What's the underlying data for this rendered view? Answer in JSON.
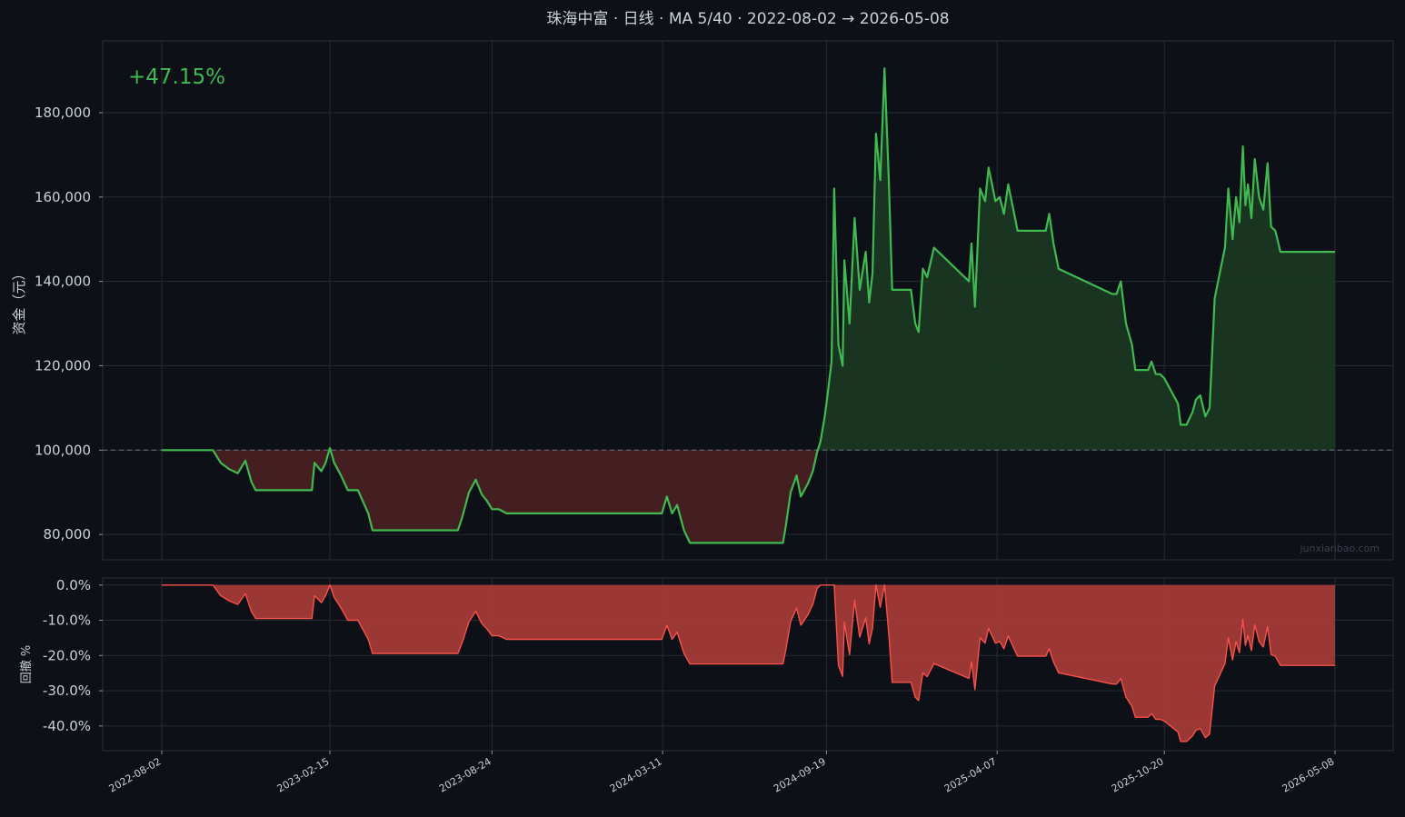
{
  "title": "珠海中富 · 日线 · MA 5/40 · 2022-08-02 → 2026-05-08",
  "watermark": "junxianbao.com",
  "return_label": "+47.15%",
  "colors": {
    "background": "#0d1017",
    "panel": "#0d1017",
    "grid": "#262b33",
    "text": "#c9d1d9",
    "equity_line": "#3fb950",
    "gain_fill": "#1b3a22",
    "loss_fill": "#4a2022",
    "drawdown_line": "#f85149",
    "drawdown_fill": "#a33a37",
    "baseline": "#6b7280"
  },
  "chart_data": [
    {
      "type": "area",
      "ylabel": "资金（元）",
      "ylim": [
        74000,
        197000
      ],
      "yticks": [
        80000,
        100000,
        120000,
        140000,
        160000,
        180000
      ],
      "ytick_labels": [
        "80,000",
        "100,000",
        "120,000",
        "140,000",
        "160,000",
        "180,000"
      ],
      "baseline": 100000,
      "x_start": "2022-08-02",
      "x_end": "2026-05-08",
      "xticks": [
        "2022-08-02",
        "2023-02-15",
        "2023-08-24",
        "2024-03-11",
        "2024-09-19",
        "2025-04-07",
        "2025-10-20",
        "2026-05-08"
      ],
      "grid": true,
      "series": [
        {
          "x": [
            "2022-08-02",
            "2022-10-01",
            "2022-10-10",
            "2022-10-20",
            "2022-10-30",
            "2022-11-08",
            "2022-11-15",
            "2022-11-20",
            "2023-01-25",
            "2023-01-28",
            "2023-02-05",
            "2023-02-10",
            "2023-02-15",
            "2023-02-20",
            "2023-02-28",
            "2023-03-08",
            "2023-03-20",
            "2023-04-01",
            "2023-04-06",
            "2023-04-12",
            "2023-05-01",
            "2023-07-15",
            "2023-07-20",
            "2023-07-28",
            "2023-08-05",
            "2023-08-12",
            "2023-08-18",
            "2023-08-24",
            "2023-09-01",
            "2023-09-10",
            "2023-09-20",
            "2023-10-05",
            "2024-01-15",
            "2024-03-01",
            "2024-03-10",
            "2024-03-16",
            "2024-03-22",
            "2024-03-28",
            "2024-04-05",
            "2024-04-12",
            "2024-04-16",
            "2024-05-01",
            "2024-07-30",
            "2024-08-02",
            "2024-08-08",
            "2024-08-15",
            "2024-08-20",
            "2024-08-28",
            "2024-09-03",
            "2024-09-08",
            "2024-09-12",
            "2024-09-17",
            "2024-09-19",
            "2024-09-25",
            "2024-09-28",
            "2024-10-03",
            "2024-10-08",
            "2024-10-10",
            "2024-10-16",
            "2024-10-22",
            "2024-10-28",
            "2024-11-04",
            "2024-11-08",
            "2024-11-12",
            "2024-11-16",
            "2024-11-21",
            "2024-11-26",
            "2024-12-01",
            "2024-12-05",
            "2024-12-10",
            "2024-12-14",
            "2024-12-18",
            "2024-12-22",
            "2024-12-27",
            "2025-01-01",
            "2025-01-05",
            "2025-01-10",
            "2025-01-15",
            "2025-01-23",
            "2025-03-05",
            "2025-03-08",
            "2025-03-12",
            "2025-03-18",
            "2025-03-24",
            "2025-03-28",
            "2025-04-01",
            "2025-04-05",
            "2025-04-10",
            "2025-04-15",
            "2025-04-20",
            "2025-04-25",
            "2025-05-01",
            "2025-05-06",
            "2025-05-10",
            "2025-05-14",
            "2025-05-18",
            "2025-05-22",
            "2025-05-26",
            "2025-05-30",
            "2025-06-03",
            "2025-06-07",
            "2025-06-12",
            "2025-06-18",
            "2025-08-20",
            "2025-08-25",
            "2025-08-30",
            "2025-09-05",
            "2025-09-12",
            "2025-09-16",
            "2025-09-22",
            "2025-09-25",
            "2025-10-01",
            "2025-10-05",
            "2025-10-10",
            "2025-10-15",
            "2025-10-20",
            "2025-11-05",
            "2025-11-08",
            "2025-11-15",
            "2025-11-22",
            "2025-11-26",
            "2025-12-01",
            "2025-12-07",
            "2025-12-12",
            "2025-12-18",
            "2025-12-24",
            "2025-12-30",
            "2026-01-03",
            "2026-01-08",
            "2026-01-12",
            "2026-01-16",
            "2026-01-20",
            "2026-01-23",
            "2026-01-26",
            "2026-01-30",
            "2026-02-03",
            "2026-02-08",
            "2026-02-13",
            "2026-02-18",
            "2026-02-22",
            "2026-02-27",
            "2026-03-05",
            "2026-05-08"
          ],
          "y": [
            100000,
            100000,
            97000,
            95500,
            94500,
            97500,
            92500,
            90500,
            90500,
            97000,
            95000,
            97000,
            100500,
            97000,
            94000,
            90500,
            90500,
            85000,
            81000,
            81000,
            81000,
            81000,
            84000,
            90000,
            93000,
            89500,
            88000,
            86000,
            86000,
            85000,
            85000,
            85000,
            85000,
            85000,
            85000,
            89000,
            85000,
            87000,
            81000,
            78000,
            78000,
            78000,
            78000,
            81500,
            90000,
            94000,
            89000,
            92000,
            95000,
            99500,
            102000,
            108000,
            111000,
            121000,
            162000,
            125000,
            120000,
            145000,
            130000,
            155000,
            138000,
            147000,
            135000,
            142000,
            175000,
            164000,
            190500,
            164000,
            138000,
            138000,
            138000,
            138000,
            138000,
            138000,
            130000,
            128000,
            143000,
            141000,
            148000,
            140000,
            149000,
            134000,
            162000,
            159000,
            167000,
            163000,
            159000,
            160000,
            156000,
            163000,
            158000,
            152000,
            152000,
            152000,
            152000,
            152000,
            152000,
            152000,
            152000,
            152000,
            156000,
            149000,
            143000,
            137000,
            137000,
            140000,
            130000,
            125000,
            119000,
            119000,
            119000,
            119000,
            121000,
            118000,
            118000,
            117000,
            111000,
            106000,
            106000,
            109000,
            112000,
            113000,
            108000,
            110000,
            136000,
            142000,
            148000,
            162000,
            150000,
            160000,
            154000,
            172000,
            158000,
            163000,
            155000,
            169000,
            160000,
            157000,
            168000,
            153000,
            152000,
            147000,
            147000
          ]
        }
      ]
    },
    {
      "type": "area",
      "ylabel": "回撤 %",
      "ylim": [
        -47,
        2
      ],
      "yticks": [
        0,
        -10,
        -20,
        -30,
        -40
      ],
      "ytick_labels": [
        "0.0%",
        "-10.0%",
        "-20.0%",
        "-30.0%",
        "-40.0%"
      ],
      "grid": true,
      "series": [
        {
          "x": [
            "2022-08-02",
            "2022-10-01",
            "2022-10-10",
            "2022-10-20",
            "2022-10-30",
            "2022-11-08",
            "2022-11-15",
            "2022-11-20",
            "2023-01-25",
            "2023-01-28",
            "2023-02-05",
            "2023-02-10",
            "2023-02-15",
            "2023-02-20",
            "2023-02-28",
            "2023-03-08",
            "2023-03-20",
            "2023-04-01",
            "2023-04-06",
            "2023-04-12",
            "2023-05-01",
            "2023-07-15",
            "2023-07-20",
            "2023-07-28",
            "2023-08-05",
            "2023-08-12",
            "2023-08-18",
            "2023-08-24",
            "2023-09-01",
            "2023-09-10",
            "2023-09-20",
            "2023-10-05",
            "2024-01-15",
            "2024-03-01",
            "2024-03-10",
            "2024-03-16",
            "2024-03-22",
            "2024-03-28",
            "2024-04-05",
            "2024-04-12",
            "2024-04-16",
            "2024-05-01",
            "2024-07-30",
            "2024-08-02",
            "2024-08-08",
            "2024-08-15",
            "2024-08-20",
            "2024-08-28",
            "2024-09-03",
            "2024-09-08",
            "2024-09-12",
            "2024-09-17",
            "2024-09-19",
            "2024-09-25",
            "2024-09-28",
            "2024-10-03",
            "2024-10-08",
            "2024-10-10",
            "2024-10-16",
            "2024-10-22",
            "2024-10-28",
            "2024-11-04",
            "2024-11-08",
            "2024-11-12",
            "2024-11-16",
            "2024-11-21",
            "2024-11-26",
            "2024-12-01",
            "2024-12-05",
            "2024-12-10",
            "2024-12-14",
            "2024-12-18",
            "2024-12-22",
            "2024-12-27",
            "2025-01-01",
            "2025-01-05",
            "2025-01-10",
            "2025-01-15",
            "2025-01-23",
            "2025-03-05",
            "2025-03-08",
            "2025-03-12",
            "2025-03-18",
            "2025-03-24",
            "2025-03-28",
            "2025-04-01",
            "2025-04-05",
            "2025-04-10",
            "2025-04-15",
            "2025-04-20",
            "2025-04-25",
            "2025-05-01",
            "2025-05-06",
            "2025-05-10",
            "2025-05-14",
            "2025-05-18",
            "2025-05-22",
            "2025-05-26",
            "2025-05-30",
            "2025-06-03",
            "2025-06-07",
            "2025-06-12",
            "2025-06-18",
            "2025-08-20",
            "2025-08-25",
            "2025-08-30",
            "2025-09-05",
            "2025-09-12",
            "2025-09-16",
            "2025-09-22",
            "2025-09-25",
            "2025-10-01",
            "2025-10-05",
            "2025-10-10",
            "2025-10-15",
            "2025-10-20",
            "2025-11-05",
            "2025-11-08",
            "2025-11-15",
            "2025-11-22",
            "2025-11-26",
            "2025-12-01",
            "2025-12-07",
            "2025-12-12",
            "2025-12-18",
            "2025-12-24",
            "2025-12-30",
            "2026-01-03",
            "2026-01-08",
            "2026-01-12",
            "2026-01-16",
            "2026-01-20",
            "2026-01-23",
            "2026-01-26",
            "2026-01-30",
            "2026-02-03",
            "2026-02-08",
            "2026-02-13",
            "2026-02-18",
            "2026-02-22",
            "2026-02-27",
            "2026-03-05",
            "2026-05-08"
          ],
          "y": [
            0.0,
            0.0,
            -3.0,
            -4.5,
            -5.5,
            -2.5,
            -7.5,
            -9.5,
            -9.5,
            -3.0,
            -5.0,
            -3.0,
            0.0,
            -3.5,
            -6.5,
            -10.0,
            -10.0,
            -15.4,
            -19.4,
            -19.4,
            -19.4,
            -19.4,
            -16.4,
            -10.4,
            -7.5,
            -10.9,
            -12.4,
            -14.4,
            -14.4,
            -15.4,
            -15.4,
            -15.4,
            -15.4,
            -15.4,
            -15.4,
            -11.4,
            -15.4,
            -13.4,
            -19.4,
            -22.4,
            -22.4,
            -22.4,
            -22.4,
            -18.9,
            -10.4,
            -6.5,
            -11.4,
            -8.5,
            -5.5,
            -1.0,
            0.0,
            0.0,
            0.0,
            0.0,
            0.0,
            -22.8,
            -25.9,
            -10.5,
            -19.8,
            -4.3,
            -14.8,
            -9.3,
            -16.7,
            -12.3,
            0.0,
            -6.3,
            0.0,
            -13.9,
            -27.6,
            -27.6,
            -27.6,
            -27.6,
            -27.6,
            -27.6,
            -31.8,
            -32.8,
            -24.9,
            -26.0,
            -22.3,
            -26.5,
            -21.8,
            -29.7,
            -15.0,
            -16.5,
            -12.3,
            -14.4,
            -16.5,
            -16.0,
            -18.1,
            -14.4,
            -17.1,
            -20.2,
            -20.2,
            -20.2,
            -20.2,
            -20.2,
            -20.2,
            -20.2,
            -20.2,
            -20.2,
            -18.1,
            -21.8,
            -24.9,
            -28.1,
            -28.1,
            -26.5,
            -31.8,
            -34.4,
            -37.5,
            -37.5,
            -37.5,
            -37.5,
            -36.5,
            -38.1,
            -38.1,
            -38.6,
            -41.7,
            -44.4,
            -44.4,
            -42.8,
            -41.2,
            -40.7,
            -43.3,
            -42.3,
            -28.6,
            -25.5,
            -22.3,
            -15.0,
            -21.3,
            -16.0,
            -19.2,
            -9.7,
            -17.1,
            -14.4,
            -18.6,
            -11.3,
            -16.0,
            -17.6,
            -11.8,
            -19.7,
            -20.2,
            -22.8,
            -22.8
          ]
        }
      ]
    }
  ]
}
